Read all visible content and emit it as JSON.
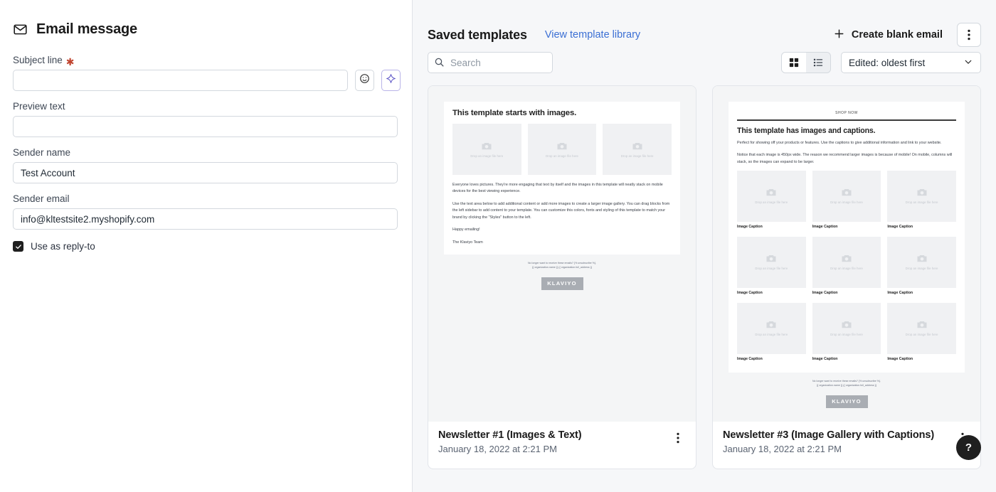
{
  "left": {
    "icon": "envelope-icon",
    "title": "Email message",
    "fields": {
      "subject": {
        "label": "Subject line",
        "required_mark": "✱",
        "value": "",
        "placeholder": ""
      },
      "preview": {
        "label": "Preview text",
        "value": "",
        "placeholder": ""
      },
      "sender_name": {
        "label": "Sender name",
        "value": "Test Account",
        "placeholder": ""
      },
      "sender_email": {
        "label": "Sender email",
        "value": "info@kltestsite2.myshopify.com",
        "placeholder": ""
      }
    },
    "buttons": {
      "emoji": "emoji-picker-icon",
      "ai": "ai-sparkle-icon"
    },
    "reply_to": {
      "label": "Use as reply-to",
      "checked": true
    }
  },
  "right": {
    "heading": "Saved templates",
    "library_link": "View template library",
    "create_button": "Create blank email",
    "more_menu": "⋮",
    "search": {
      "value": "",
      "placeholder": "Search"
    },
    "view_modes": [
      {
        "name": "grid",
        "active": true
      },
      {
        "name": "list",
        "active": false
      }
    ],
    "sort": {
      "value": "Edited: oldest first",
      "caret": "chevron-down-icon"
    },
    "help_button": "?",
    "templates": [
      {
        "name": "Newsletter #1 (Images & Text)",
        "date": "January 18, 2022 at 2:21 PM",
        "preview": {
          "kind": "images-and-text",
          "heading": "This template starts with images.",
          "placeholder_caption": "Drop an image file here",
          "placeholder_count": 3,
          "paragraphs": [
            "Everyone loves pictures. They're more engaging that text by itself and the images in this template will neatly stack on mobile devices for the best viewing experience.",
            "Use the text area below to add additional content or add more images to create a larger image gallery. You can drag blocks from the left sidebar to add content to your template. You can customize this colors, fonts and styling of this template to match your brand by clicking the \"Styles\" button to the left.",
            "Happy emailing!",
            "The Klaviyo Team"
          ],
          "footer_line1": "No longer want to receive these emails? {% unsubscribe %}.",
          "footer_line2": "{{ organization.name }} {{ organization.full_address }}",
          "logo": "KLAVIYO"
        }
      },
      {
        "name": "Newsletter #3 (Image Gallery with Captions)",
        "date": "January 18, 2022 at 2:21 PM",
        "preview": {
          "kind": "image-gallery-captions",
          "shop_now": "SHOP NOW",
          "heading": "This template has images and captions.",
          "placeholder_caption": "Drop an image file here",
          "paragraphs": [
            "Perfect for showing off your products or features. Use the captions to give additional information and link to your website.",
            "Notice that each image is 450px wide. The reason we recommend larger images is because of mobile! On mobile, columns will stack, so the images can expand to be larger."
          ],
          "captions": [
            "Image Caption",
            "Image Caption",
            "Image Caption"
          ],
          "gallery_rows": 3,
          "footer_line1": "No longer want to receive these emails? {% unsubscribe %}.",
          "footer_line2": "{{ organization.name }} {{ organization.full_address }}",
          "logo": "KLAVIYO"
        }
      }
    ]
  },
  "colors": {
    "accent_link": "#3b6fd4",
    "ai_purple": "#5b53c6",
    "required_red": "#c0442f",
    "panel_bg": "#f6f7f9"
  }
}
